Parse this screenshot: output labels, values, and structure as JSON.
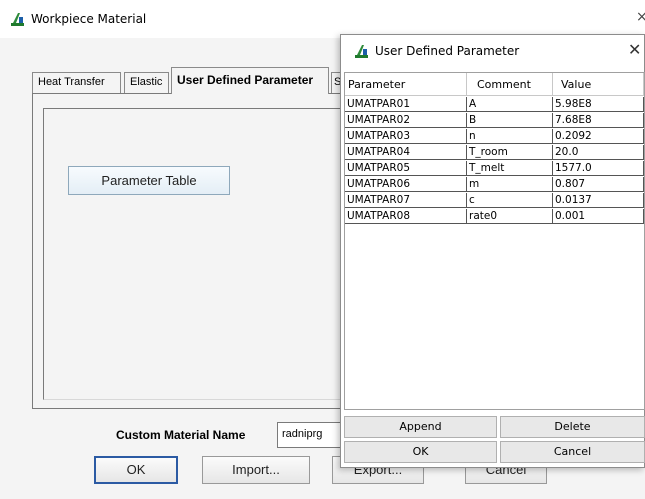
{
  "main_window": {
    "title": "Workpiece Material",
    "close_glyph": "×",
    "tabs": [
      "Heat Transfer",
      "Elastic",
      "User Defined Parameter",
      "S"
    ],
    "parameter_table_button": "Parameter Table",
    "custom_material_name_label": "Custom Material Name",
    "custom_material_name_value": "radniprg",
    "buttons": {
      "ok": "OK",
      "import": "Import...",
      "export": "Export...",
      "cancel": "Cancel"
    }
  },
  "dialog": {
    "title": "User Defined Parameter",
    "close_glyph": "✕",
    "columns": [
      "Parameter",
      "Comment",
      "Value"
    ],
    "rows": [
      [
        "UMATPAR01",
        "A",
        "5.98E8"
      ],
      [
        "UMATPAR02",
        "B",
        "7.68E8"
      ],
      [
        "UMATPAR03",
        "n",
        "0.2092"
      ],
      [
        "UMATPAR04",
        "T_room",
        "20.0"
      ],
      [
        "UMATPAR05",
        "T_melt",
        "1577.0"
      ],
      [
        "UMATPAR06",
        "m",
        "0.807"
      ],
      [
        "UMATPAR07",
        "c",
        "0.0137"
      ],
      [
        "UMATPAR08",
        "rate0",
        "0.001"
      ]
    ],
    "buttons": {
      "append": "Append",
      "delete": "Delete",
      "ok": "OK",
      "cancel": "Cancel"
    }
  },
  "colors": {
    "icon_green": "#2e8b3a",
    "default_button_border": "#2b5aa3",
    "param_button_border": "#8ea8bb"
  }
}
